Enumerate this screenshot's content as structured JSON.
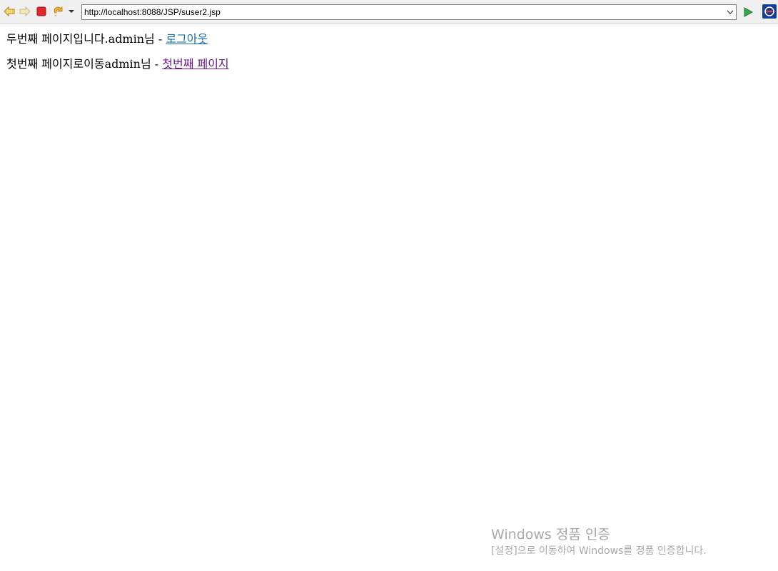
{
  "browser": {
    "url": "http://localhost:8088/JSP/suser2.jsp",
    "icons": [
      "back-icon",
      "forward-icon",
      "stop-icon",
      "refresh-icon",
      "menu-dropdown-icon",
      "url-dropdown-icon",
      "go-icon",
      "browser-logo-icon"
    ]
  },
  "page": {
    "line1": {
      "text": "두번째 페이지입니다.admin님 - ",
      "link": "로그아웃"
    },
    "line2": {
      "text": "첫번째 페이지로이동admin님 - ",
      "link": "첫번째 페이지"
    }
  },
  "watermark": {
    "title": "Windows 정품 인증",
    "subtitle": "[설정]으로 이동하여 Windows를 정품 인증합니다."
  },
  "colors": {
    "link_unvisited": "#1a6fa8",
    "link_visited": "#6b1a8a",
    "toolbar_bg": "#f0f0f0",
    "watermark": "#a9a9a9"
  }
}
